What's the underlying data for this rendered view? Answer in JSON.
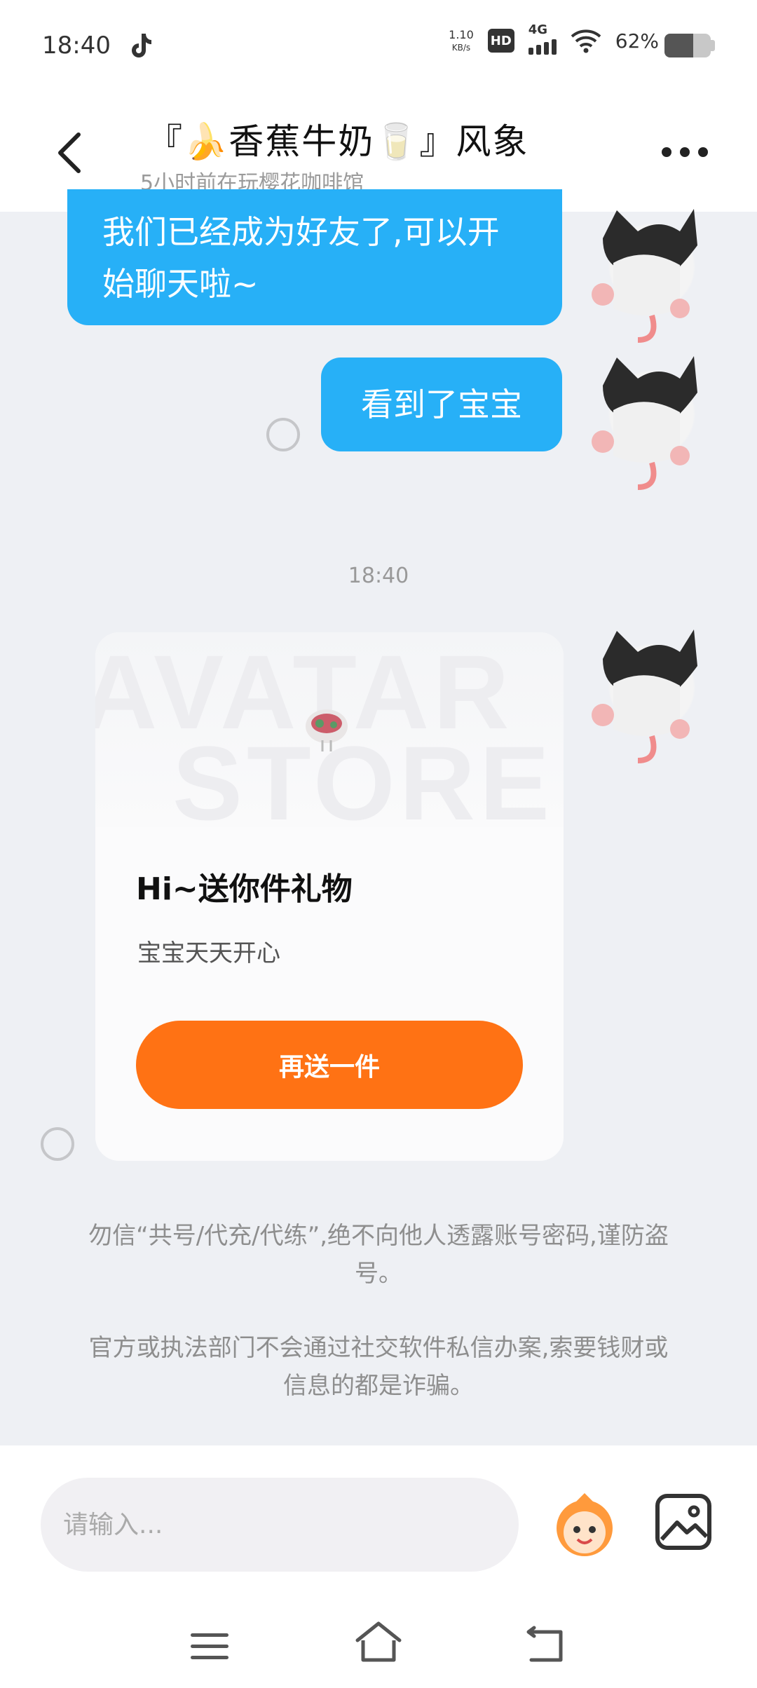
{
  "status_bar": {
    "time": "18:40",
    "net_speed_value": "1.10",
    "net_speed_unit": "KB/s",
    "hd_label": "HD",
    "network_label": "4G",
    "battery_percent": "62%",
    "battery_level": 0.62,
    "icons": [
      "tiktok-icon",
      "signal-icon",
      "wifi-icon",
      "battery-icon"
    ]
  },
  "header": {
    "title": "『🍌香蕉牛奶🥛』风象",
    "subtitle": "5小时前在玩樱花咖啡馆",
    "icons": [
      "back-icon",
      "more-icon"
    ]
  },
  "messages": [
    {
      "text": "我们已经成为好友了,可以开始聊天啦~"
    },
    {
      "text": "看到了宝宝"
    }
  ],
  "chat_time": "18:40",
  "gift_card": {
    "watermark_line1": "AVATAR",
    "watermark_line2": "STORE",
    "title": "Hi~送你件礼物",
    "message": "宝宝天天开心",
    "button_label": "再送一件"
  },
  "notices": [
    "勿信“共号/代充/代练”,绝不向他人透露账号密码,谨防盗号。",
    "官方或执法部门不会通过社交软件私信办案,索要钱财或信息的都是诈骗。"
  ],
  "input_bar": {
    "placeholder": "请输入...",
    "icons": [
      "sticker-icon",
      "image-icon"
    ]
  },
  "nav_bar": {
    "icons": [
      "menu-icon",
      "home-icon",
      "back-nav-icon"
    ]
  },
  "colors": {
    "bubble": "#27b0f7",
    "gift_button": "#ff7214",
    "background": "#eef0f4"
  }
}
